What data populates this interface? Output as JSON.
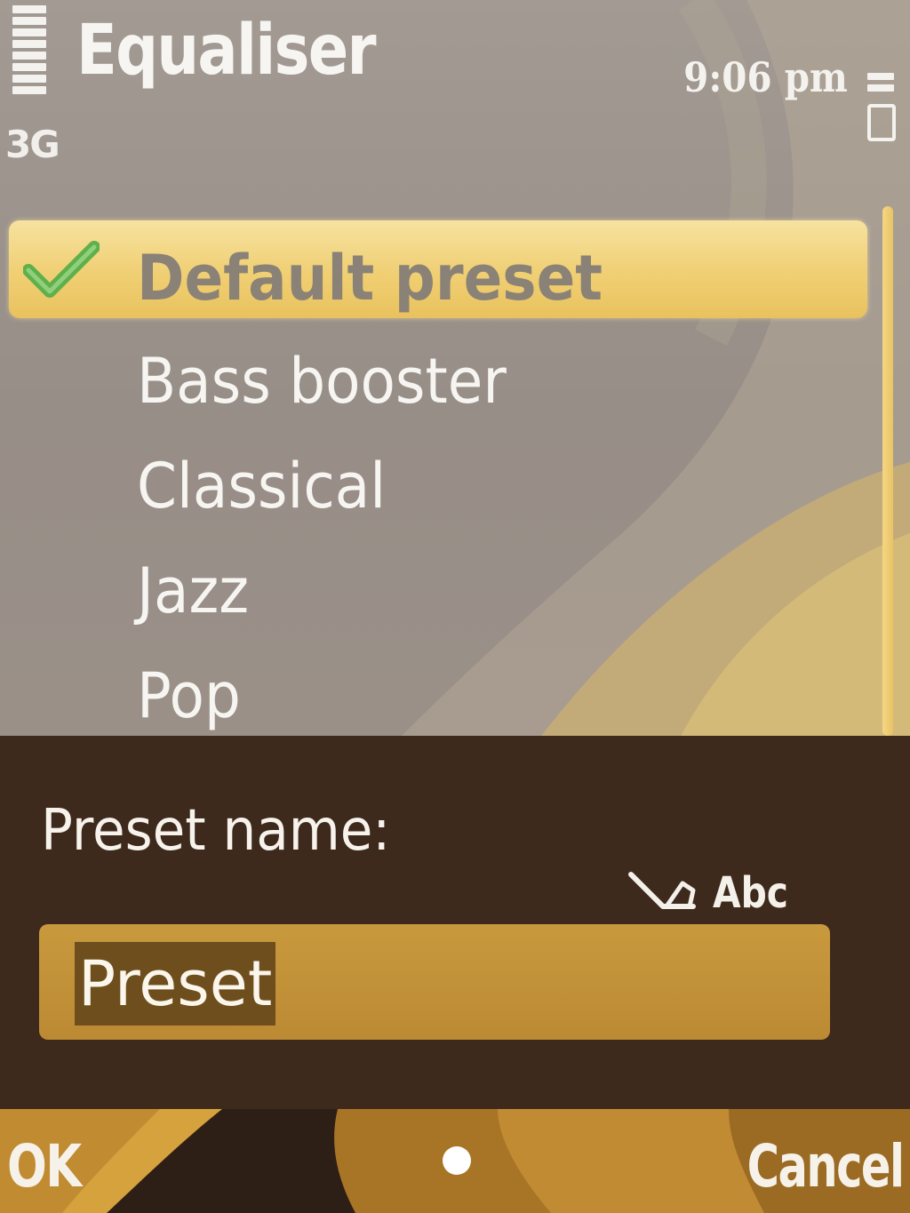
{
  "status_bar": {
    "network_type": "3G",
    "time": "9:06 pm",
    "signal_icon": "signal-strength-icon",
    "battery_icon": "battery-icon"
  },
  "header": {
    "title": "Equaliser"
  },
  "preset_list": {
    "items": [
      {
        "label": "Default preset",
        "selected": true,
        "active": true
      },
      {
        "label": "Bass booster",
        "selected": false,
        "active": false
      },
      {
        "label": "Classical",
        "selected": false,
        "active": false
      },
      {
        "label": "Jazz",
        "selected": false,
        "active": false
      },
      {
        "label": "Pop",
        "selected": false,
        "active": false
      }
    ],
    "check_icon": "check-icon"
  },
  "dialog": {
    "label": "Preset name:",
    "input_mode": "Abc",
    "input_mode_icon": "pencil-icon",
    "value": "Preset"
  },
  "softkeys": {
    "left": "OK",
    "middle_icon": "dot-icon",
    "right": "Cancel"
  },
  "colors": {
    "highlight": "#f0cf73",
    "dialog_bg": "#3e2a1c",
    "field_bg": "#c9993e",
    "text_selection": "#6e4e1c",
    "check": "#5fb04c"
  }
}
